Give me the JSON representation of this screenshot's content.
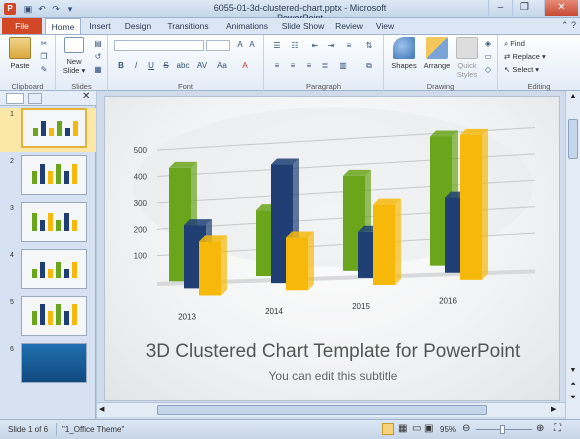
{
  "window": {
    "title": "6055-01-3d-clustered-chart.pptx - Microsoft PowerPoint",
    "app_icon": "P",
    "controls": [
      "–",
      "❐",
      "✕"
    ]
  },
  "tabs": [
    "File",
    "Home",
    "Insert",
    "Design",
    "Transitions",
    "Animations",
    "Slide Show",
    "Review",
    "View"
  ],
  "ribbon": {
    "clipboard": {
      "label": "Clipboard",
      "paste": "Paste"
    },
    "slides": {
      "label": "Slides",
      "new_slide": "New Slide ▾"
    },
    "font": {
      "label": "Font",
      "bold": "B",
      "italic": "I",
      "underline": "U",
      "strike": "S",
      "shadow": "abc",
      "spacing": "AV",
      "case": "Aa",
      "color": "A"
    },
    "paragraph": {
      "label": "Paragraph"
    },
    "drawing": {
      "label": "Drawing",
      "shapes": "Shapes",
      "arrange": "Arrange",
      "quick_styles": "Quick Styles"
    },
    "editing": {
      "label": "Editing",
      "find": "Find",
      "replace": "Replace ▾",
      "select": "Select ▾"
    }
  },
  "thumbnails": [
    {
      "num": "1",
      "selected": true
    },
    {
      "num": "2",
      "selected": false
    },
    {
      "num": "3",
      "selected": false
    },
    {
      "num": "4",
      "selected": false
    },
    {
      "num": "5",
      "selected": false
    },
    {
      "num": "6",
      "selected": false
    }
  ],
  "slide": {
    "title": "3D Clustered Chart Template for PowerPoint",
    "subtitle": "You can edit this subtitle"
  },
  "chart_data": {
    "type": "bar",
    "categories": [
      "2013",
      "2014",
      "2015",
      "2016"
    ],
    "series": [
      {
        "values": [
          430,
          250,
          360,
          490
        ],
        "color": "#6aa51c"
      },
      {
        "values": [
          240,
          450,
          175,
          285
        ],
        "color": "#1f3f74"
      },
      {
        "values": [
          205,
          200,
          305,
          550
        ],
        "color": "#f6b90a"
      }
    ],
    "yticks": [
      "100",
      "200",
      "300",
      "400",
      "500"
    ],
    "ylim": [
      0,
      550
    ]
  },
  "status": {
    "slide": "Slide 1 of 6",
    "theme": "\"1_Office Theme\"",
    "zoom": "95%"
  }
}
